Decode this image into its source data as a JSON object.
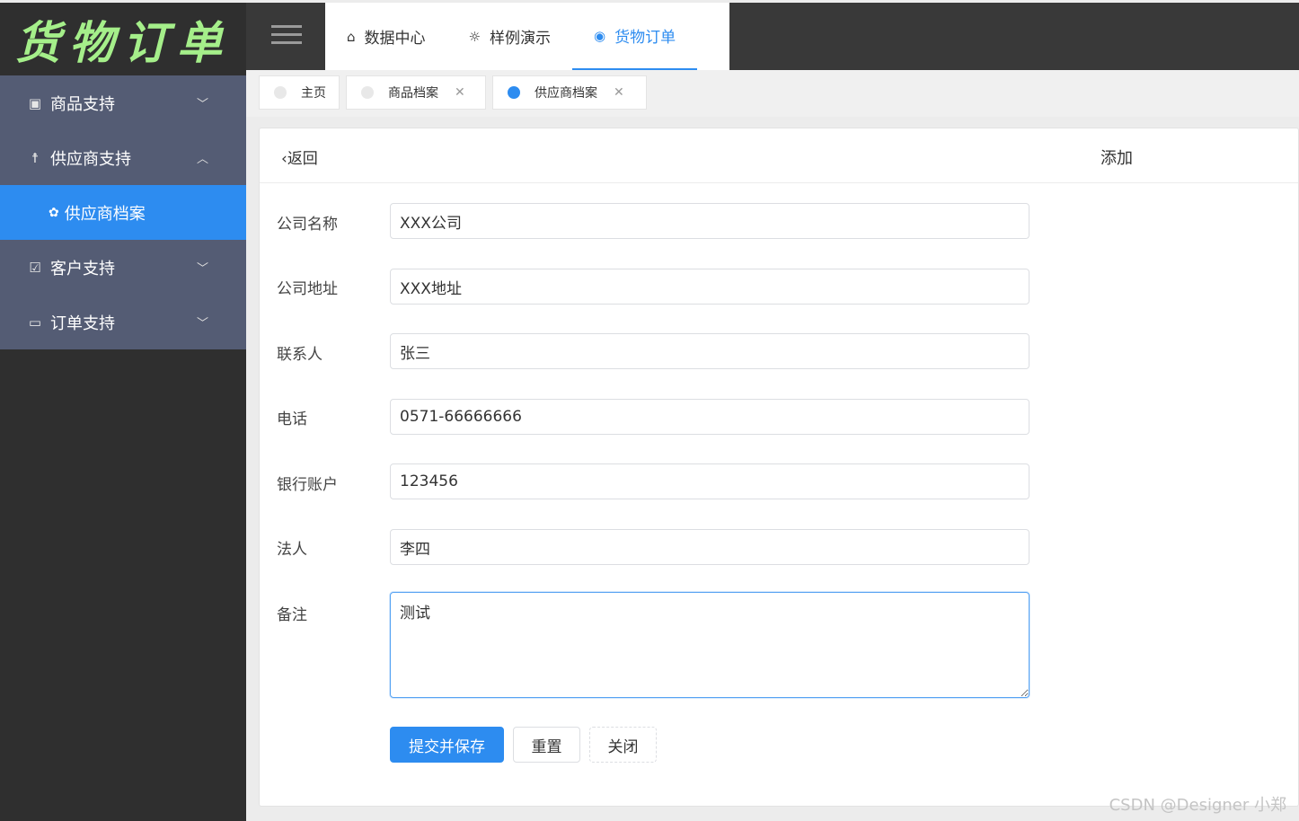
{
  "logo": {
    "text": "货物订单"
  },
  "topnav": {
    "items": [
      {
        "label": "数据中心",
        "icon": "home-icon"
      },
      {
        "label": "样例演示",
        "icon": "lightbulb-icon"
      },
      {
        "label": "货物订单",
        "icon": "aperture-icon",
        "active": true
      }
    ]
  },
  "sidebar": {
    "groups": [
      {
        "label": "商品支持",
        "icon": "document-icon",
        "expanded": false
      },
      {
        "label": "供应商支持",
        "icon": "person-icon",
        "expanded": true,
        "children": [
          {
            "label": "供应商档案",
            "icon": "flower-icon",
            "active": true
          }
        ]
      },
      {
        "label": "客户支持",
        "icon": "checkbox-icon",
        "expanded": false
      },
      {
        "label": "订单支持",
        "icon": "folder-icon",
        "expanded": false
      }
    ]
  },
  "tabs": [
    {
      "label": "主页",
      "closable": false,
      "active": false
    },
    {
      "label": "商品档案",
      "closable": true,
      "active": false
    },
    {
      "label": "供应商档案",
      "closable": true,
      "active": true
    }
  ],
  "header": {
    "back_label": "返回",
    "title": "添加"
  },
  "form": {
    "company_name": {
      "label": "公司名称",
      "value": "XXX公司"
    },
    "company_address": {
      "label": "公司地址",
      "value": "XXX地址"
    },
    "contact": {
      "label": "联系人",
      "value": "张三"
    },
    "phone": {
      "label": "电话",
      "value": "0571-66666666"
    },
    "bank_account": {
      "label": "银行账户",
      "value": "123456"
    },
    "legal_person": {
      "label": "法人",
      "value": "李四"
    },
    "remark": {
      "label": "备注",
      "value": "测试"
    }
  },
  "buttons": {
    "submit": "提交并保存",
    "reset": "重置",
    "close": "关闭"
  },
  "watermark": "CSDN @Designer 小郑",
  "colors": {
    "accent": "#2d8cf0",
    "sidebar_group": "#545c74",
    "logo_text": "#a5ef8a"
  }
}
